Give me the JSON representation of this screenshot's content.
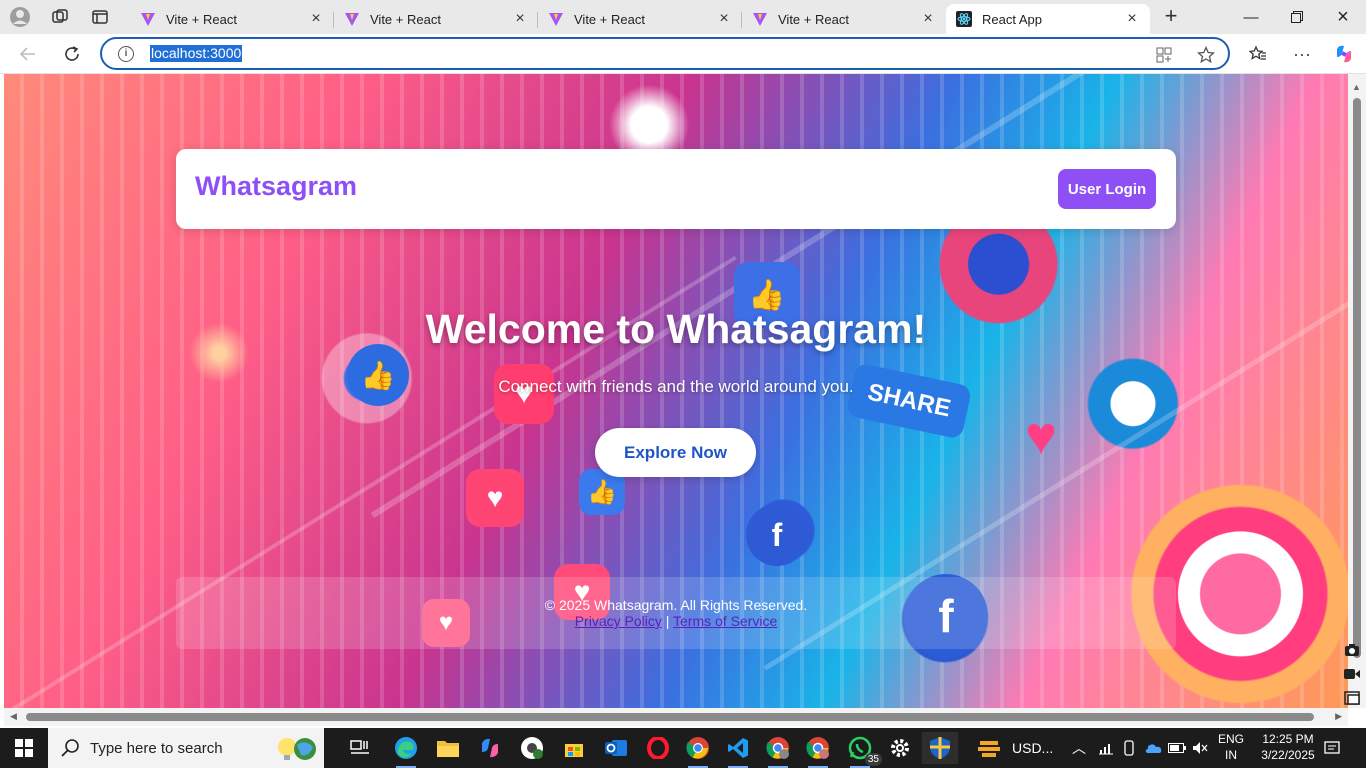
{
  "browser": {
    "tabs": [
      {
        "title": "Vite + React",
        "active": false
      },
      {
        "title": "Vite + React",
        "active": false
      },
      {
        "title": "Vite + React",
        "active": false
      },
      {
        "title": "Vite + React",
        "active": false
      },
      {
        "title": "React App",
        "active": true
      }
    ],
    "url": "localhost:3000"
  },
  "page": {
    "brand": "Whatsagram",
    "login_label": "User Login",
    "hero_title": "Welcome to Whatsagram!",
    "hero_subtitle": "Connect with friends and the world around you.",
    "cta_label": "Explore Now",
    "footer_copyright": "© 2025 Whatsagram. All Rights Reserved.",
    "privacy_link": "Privacy Policy",
    "link_separator": "|",
    "terms_link": "Terms of Service",
    "accent_color": "#8e4ff5",
    "cta_text_color": "#1f55c8"
  },
  "taskbar": {
    "search_placeholder": "Type here to search",
    "weather": "USD...",
    "whatsapp_badge": "35",
    "language_top": "ENG",
    "language_bottom": "IN",
    "time": "12:25 PM",
    "date": "3/22/2025"
  }
}
